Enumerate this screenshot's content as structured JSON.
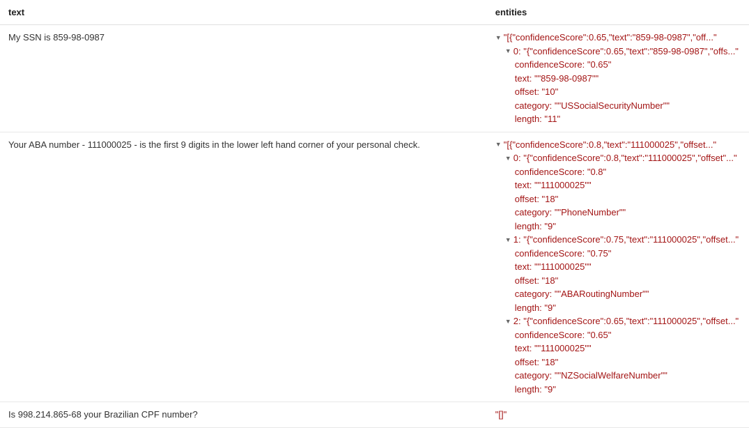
{
  "headers": {
    "text": "text",
    "entities": "entities"
  },
  "rows": [
    {
      "text": "My SSN is 859-98-0987",
      "tree": [
        {
          "indent": 0,
          "toggle": "▼",
          "summary": "\"[{\"confidenceScore\":0.65,\"text\":\"859-98-0987\",\"off...\""
        },
        {
          "indent": 1,
          "toggle": "▼",
          "key": "0",
          "summary": "\"{\"confidenceScore\":0.65,\"text\":\"859-98-0987\",\"offs...\""
        },
        {
          "indent": 2,
          "key": "confidenceScore",
          "val": "\"0.65\""
        },
        {
          "indent": 2,
          "key": "text",
          "val": "\"\"859-98-0987\"\""
        },
        {
          "indent": 2,
          "key": "offset",
          "val": "\"10\""
        },
        {
          "indent": 2,
          "key": "category",
          "val": "\"\"USSocialSecurityNumber\"\""
        },
        {
          "indent": 2,
          "key": "length",
          "val": "\"11\""
        }
      ]
    },
    {
      "text": "Your ABA number - 111000025 - is the first 9 digits in the lower left hand corner of your personal check.",
      "tree": [
        {
          "indent": 0,
          "toggle": "▼",
          "summary": "\"[{\"confidenceScore\":0.8,\"text\":\"111000025\",\"offset...\""
        },
        {
          "indent": 1,
          "toggle": "▼",
          "key": "0",
          "summary": "\"{\"confidenceScore\":0.8,\"text\":\"111000025\",\"offset\"...\""
        },
        {
          "indent": 2,
          "key": "confidenceScore",
          "val": "\"0.8\""
        },
        {
          "indent": 2,
          "key": "text",
          "val": "\"\"111000025\"\""
        },
        {
          "indent": 2,
          "key": "offset",
          "val": "\"18\""
        },
        {
          "indent": 2,
          "key": "category",
          "val": "\"\"PhoneNumber\"\""
        },
        {
          "indent": 2,
          "key": "length",
          "val": "\"9\""
        },
        {
          "indent": 1,
          "toggle": "▼",
          "key": "1",
          "summary": "\"{\"confidenceScore\":0.75,\"text\":\"111000025\",\"offset...\""
        },
        {
          "indent": 2,
          "key": "confidenceScore",
          "val": "\"0.75\""
        },
        {
          "indent": 2,
          "key": "text",
          "val": "\"\"111000025\"\""
        },
        {
          "indent": 2,
          "key": "offset",
          "val": "\"18\""
        },
        {
          "indent": 2,
          "key": "category",
          "val": "\"\"ABARoutingNumber\"\""
        },
        {
          "indent": 2,
          "key": "length",
          "val": "\"9\""
        },
        {
          "indent": 1,
          "toggle": "▼",
          "key": "2",
          "summary": "\"{\"confidenceScore\":0.65,\"text\":\"111000025\",\"offset...\""
        },
        {
          "indent": 2,
          "key": "confidenceScore",
          "val": "\"0.65\""
        },
        {
          "indent": 2,
          "key": "text",
          "val": "\"\"111000025\"\""
        },
        {
          "indent": 2,
          "key": "offset",
          "val": "\"18\""
        },
        {
          "indent": 2,
          "key": "category",
          "val": "\"\"NZSocialWelfareNumber\"\""
        },
        {
          "indent": 2,
          "key": "length",
          "val": "\"9\""
        }
      ]
    },
    {
      "text": "Is 998.214.865-68 your Brazilian CPF number?",
      "tree": [
        {
          "indent": 0,
          "summary": "\"[]\""
        }
      ]
    }
  ]
}
